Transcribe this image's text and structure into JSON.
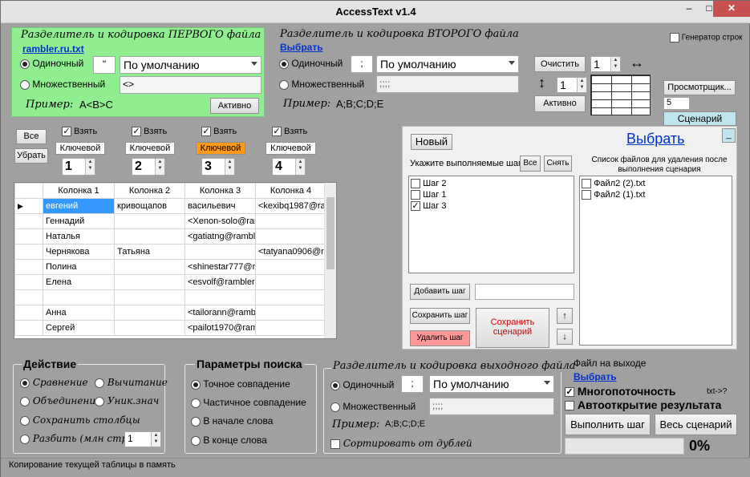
{
  "window": {
    "title": "AccessText v1.4",
    "minimize": "–",
    "maximize": "□",
    "close": "✕"
  },
  "first": {
    "heading": "Разделитель и кодировка ПЕРВОГО файла",
    "file_link": "rambler.ru.txt",
    "single_label": "Одиночный",
    "single_value": "\"",
    "encoding": "По умолчанию",
    "multi_label": "Множественный",
    "multi_value": "<>",
    "example_label": "Пример:",
    "example_value": "A<B>C",
    "active_button": "Активно"
  },
  "second": {
    "heading": "Разделитель и кодировка ВТОРОГО файла",
    "choose_link": "Выбрать",
    "single_label": "Одиночный",
    "single_value": ";",
    "encoding": "По умолчанию",
    "multi_label": "Множественный",
    "multi_value": ";;;;",
    "example_label": "Пример:",
    "example_value": "A;B;C;D;E",
    "clear_button": "Очистить",
    "spin1": "1",
    "spin2": "1",
    "active_button": "Активно",
    "h_arrow": "↔",
    "v_arrow": "↕"
  },
  "right_top": {
    "generator_label": "Генератор строк",
    "viewer_button": "Просмотрщик...",
    "viewer_value": "5",
    "scenario_button": "Сценарий"
  },
  "columns_ctrl": {
    "all_button": "Все",
    "remove_button": "Убрать",
    "cols": [
      {
        "take": "Взять",
        "key": "Ключевой",
        "num": "1"
      },
      {
        "take": "Взять",
        "key": "Ключевой",
        "num": "2"
      },
      {
        "take": "Взять",
        "key": "Ключевой",
        "num": "3"
      },
      {
        "take": "Взять",
        "key": "Ключевой",
        "num": "4"
      }
    ]
  },
  "grid": {
    "headers": [
      "Колонка 1",
      "Колонка 2",
      "Колонка 3",
      "Колонка 4"
    ],
    "rows": [
      [
        "евгений",
        "кривощапов",
        "васильевич",
        "<kexibq1987@ra..."
      ],
      [
        "Геннадий",
        "",
        "<Xenon-solo@ram...",
        ""
      ],
      [
        "Наталья",
        "",
        "<gatiatng@rambl...",
        ""
      ],
      [
        "Чернякова",
        "Татьяна",
        "",
        "<tatyana0906@r..."
      ],
      [
        "Полина",
        "",
        "<shinestar777@r...",
        ""
      ],
      [
        "Елена",
        "",
        "<esvolf@rambler....",
        ""
      ],
      [
        "",
        "",
        "",
        ""
      ],
      [
        "Анна",
        "",
        "<tailorann@rambl...",
        ""
      ],
      [
        "Сергей",
        "",
        "<pailot1970@ram...",
        ""
      ]
    ]
  },
  "scenario": {
    "new_button": "Новый",
    "choose_link": "Выбрать",
    "min_button": "_",
    "steps_label": "Укажите выполняемые шаги",
    "all_button": "Все",
    "uncheck_button": "Снять",
    "steps": [
      {
        "label": "Шаг 2",
        "checked": ""
      },
      {
        "label": "Шаг 1",
        "checked": ""
      },
      {
        "label": "Шаг 3",
        "checked": "✓"
      }
    ],
    "delete_files_label": "Список файлов для удаления после выполнения сценария",
    "files": [
      "Файл2 (2).txt",
      "Файл2 (1).txt"
    ],
    "add_step": "Добавить шаг",
    "save_step": "Сохранить шаг",
    "delete_step": "Удалить шаг",
    "save_scenario": "Сохранить сценарий",
    "up": "↑",
    "down": "↓"
  },
  "action": {
    "heading": "Действие",
    "compare": "Сравнение",
    "subtract": "Вычитание",
    "merge": "Объединение",
    "unique": "Уник.знач",
    "save_cols": "Сохранить столбцы",
    "split": "Разбить (млн стр.)",
    "split_value": "1"
  },
  "search": {
    "heading": "Параметры поиска",
    "exact": "Точное совпадение",
    "partial": "Частичное совпадение",
    "start": "В начале слова",
    "end": "В конце слова"
  },
  "output": {
    "heading": "Разделитель и кодировка выходного файла",
    "single_label": "Одиночный",
    "single_value": ";",
    "encoding": "По умолчанию",
    "multi_label": "Множественный",
    "multi_value": ";;;;",
    "example_label": "Пример:",
    "example_value": "A;B;C;D;E",
    "sort_label": "Сортировать от дублей"
  },
  "out_file": {
    "label": "Файл на выходе",
    "choose_link": "Выбрать",
    "multithread": "Многопоточность",
    "txt_hint": "txt->?",
    "autoopen": "Автооткрытие результата",
    "run_step": "Выполнить шаг",
    "run_all": "Весь сценарий",
    "percent": "0%"
  },
  "status": {
    "text": "Копирование текущей таблицы в память"
  }
}
